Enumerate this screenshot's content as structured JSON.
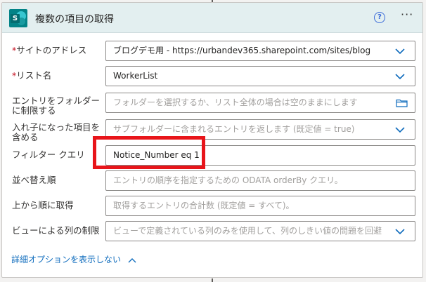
{
  "action": {
    "title": "複数の項目の取得",
    "help_glyph": "?",
    "more_glyph": "···",
    "logo_letter": "S",
    "logo_icon": "sharepoint-icon"
  },
  "fields": {
    "site": {
      "required_mark": "*",
      "label": "サイトのアドレス",
      "value": "ブログデモ用 - https://urbandev365.sharepoint.com/sites/blog"
    },
    "list": {
      "required_mark": "*",
      "label": "リスト名",
      "value": "WorkerList"
    },
    "folder": {
      "label": "エントリをフォルダーに制限する",
      "placeholder": "フォルダーを選択するか、リスト全体の場合は空のままにします"
    },
    "nested": {
      "label": "入れ子になった項目を含める",
      "placeholder": "サブフォルダーに含まれるエントリを返します (既定値 = true)"
    },
    "filter": {
      "label": "フィルター クエリ",
      "value": "Notice_Number eq 1"
    },
    "orderby": {
      "label": "並べ替え順",
      "placeholder": "エントリの順序を指定するための ODATA orderBy クエリ。"
    },
    "top": {
      "label": "上から順に取得",
      "placeholder": "取得するエントリの合計数 (既定値 = すべて)。"
    },
    "view": {
      "label": "ビューによる列の制限",
      "placeholder": "ビューで定義されている列のみを使用して、列のしきい値の問題を回避"
    }
  },
  "advanced": {
    "label": "詳細オプションを表示しない"
  },
  "colors": {
    "header_bg": "#e3eff0",
    "link": "#0f6cbd",
    "required": "#c50f1f",
    "highlight": "#e8151a",
    "chevron": "#0f6cbd"
  }
}
